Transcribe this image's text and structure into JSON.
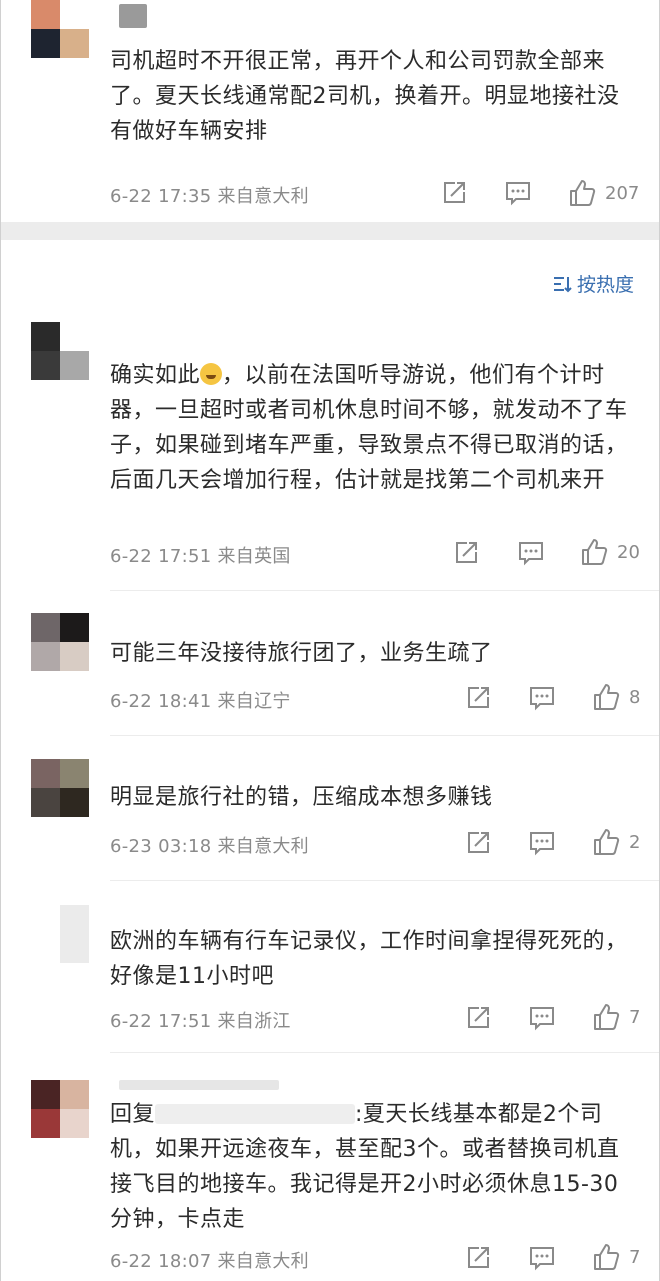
{
  "sort_label": "按热度",
  "comments": [
    {
      "text": "司机超时不开很正常，再开个人和公司罚款全部来了。夏天长线通常配2司机，换着开。明显地接社没有做好车辆安排",
      "meta": "6-22 17:35 来自意大利",
      "likes": "207",
      "avatar_colors": [
        "#d98a6a",
        "#ffffff",
        "#1e2430",
        "#d8b08a"
      ]
    },
    {
      "text_before": "确实如此",
      "text_after": "，以前在法国听导游说，他们有个计时器，一旦超时或者司机休息时间不够，就发动不了车子，如果碰到堵车严重，导致景点不得已取消的话，后面几天会增加行程，估计就是找第二个司机来开",
      "meta": "6-22 17:51 来自英国",
      "likes": "20",
      "avatar_colors": [
        "#2a2a2a",
        "#ffffff",
        "#3a3a3a",
        "#a8a8a8"
      ]
    },
    {
      "text": "可能三年没接待旅行团了，业务生疏了",
      "meta": "6-22 18:41 来自辽宁",
      "likes": "8",
      "avatar_colors": [
        "#6e6668",
        "#1c1a1a",
        "#b0a8a8",
        "#d8ccc4"
      ]
    },
    {
      "text": "明显是旅行社的错，压缩成本想多赚钱",
      "meta": "6-23 03:18 来自意大利",
      "likes": "2",
      "avatar_colors": [
        "#7a6462",
        "#8a8470",
        "#4a4440",
        "#2e2820"
      ]
    },
    {
      "text": "欧洲的车辆有行车记录仪，工作时间拿捏得死死的，好像是11小时吧",
      "meta": "6-22 17:51 来自浙江",
      "likes": "7",
      "avatar_colors": [
        "#ebebeb",
        "#ffffff",
        "#ebebeb",
        "#ffffff"
      ]
    },
    {
      "text_prefix": "回复",
      "text_after": ":夏天长线基本都是2个司机，如果开远途夜车，甚至配3个。或者替换司机直接飞目的地接车。我记得是开2小时必须休息15-30分钟，卡点走",
      "meta": "6-22 18:07 来自意大利",
      "likes": "7",
      "avatar_colors": [
        "#4a2424",
        "#d8b4a0",
        "#9a3838",
        "#e8d4cc"
      ]
    }
  ]
}
